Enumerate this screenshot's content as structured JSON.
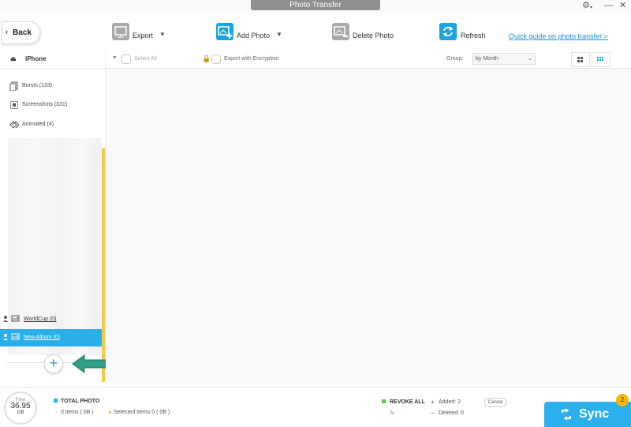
{
  "window": {
    "title": "Photo Transfer"
  },
  "toolbar": {
    "back_label": "Back",
    "export_label": "Export",
    "add_photo_label": "Add Photo",
    "delete_photo_label": "Delete Photo",
    "refresh_label": "Refresh",
    "guide_link": "Quick guide on photo transfer >"
  },
  "sidebar": {
    "device_name": "iPhone",
    "categories": [
      {
        "label": "Bursts (133)",
        "icon": "bursts-icon"
      },
      {
        "label": "Screenshots (331)",
        "icon": "screenshots-icon"
      },
      {
        "label": "Animated (4)",
        "icon": "animated-icon"
      }
    ],
    "albums": [
      {
        "label": "WorldCup (0)",
        "selected": false
      },
      {
        "label": "New Album (0)",
        "selected": true
      }
    ]
  },
  "content": {
    "select_all": "Select All",
    "export_encryption": "Export with Encryption",
    "group_label": "Group:",
    "group_value": "by Month"
  },
  "footer": {
    "free_label": "Free",
    "free_value": "36.95",
    "free_unit": "GB",
    "total_photo_label": "TOTAL PHOTO",
    "items_text": "0 items ( 0B )",
    "selected_text": "Selected Items 0 ( 0B )",
    "revoke_all": "REVOKE ALL",
    "added_text": "Added: 2",
    "deleted_text": "Deleted: 0",
    "cancel_label": "Cancel",
    "sync_label": "Sync",
    "sync_badge": "2"
  },
  "colors": {
    "accent": "#2ab0ec",
    "selected_row": "#29aeea",
    "scroll_thumb": "#f5c84b",
    "pointer_arrow": "#2e9e85",
    "badge": "#f5b800"
  }
}
